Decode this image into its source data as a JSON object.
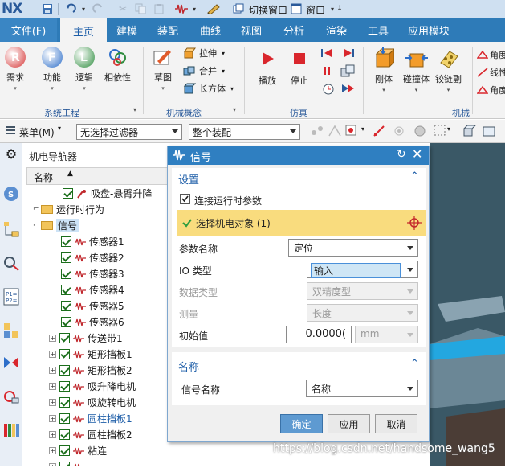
{
  "app": {
    "logo": "NX"
  },
  "qat": {
    "switch_window": "切换窗口",
    "window": "窗口"
  },
  "tabs": [
    "文件(F)",
    "主页",
    "建模",
    "装配",
    "曲线",
    "视图",
    "分析",
    "渲染",
    "工具",
    "应用模块"
  ],
  "ribbon": {
    "system_group": {
      "label": "系统工程",
      "buttons": [
        "需求",
        "功能",
        "逻辑",
        "相依性"
      ]
    },
    "mech_group": {
      "label": "机械概念",
      "sketch": "草图",
      "small": [
        "拉伸",
        "合并",
        "长方体"
      ]
    },
    "sim_group": {
      "label": "仿真",
      "buttons": [
        "播放",
        "停止"
      ]
    },
    "machine_group": {
      "label": "机械",
      "buttons": [
        "刚体",
        "碰撞体",
        "铰链副"
      ],
      "partial": [
        "角度",
        "线性",
        "角度"
      ]
    }
  },
  "selbar": {
    "menu": "菜单(M)",
    "filter": "无选择过滤器",
    "scope": "整个装配"
  },
  "navigator": {
    "title": "机电导航器",
    "column": "名称",
    "rows": [
      {
        "label": "吸盘-悬臂升降",
        "type": "item"
      },
      {
        "label": "运行时行为",
        "type": "folder"
      },
      {
        "label": "信号",
        "type": "folder-selected"
      },
      {
        "label": "传感器1",
        "type": "signal"
      },
      {
        "label": "传感器2",
        "type": "signal"
      },
      {
        "label": "传感器3",
        "type": "signal"
      },
      {
        "label": "传感器4",
        "type": "signal"
      },
      {
        "label": "传感器5",
        "type": "signal"
      },
      {
        "label": "传感器6",
        "type": "signal"
      },
      {
        "label": "传送带1",
        "type": "signal-plus"
      },
      {
        "label": "矩形挡板1",
        "type": "signal-plus"
      },
      {
        "label": "矩形挡板2",
        "type": "signal-plus"
      },
      {
        "label": "吸升降电机",
        "type": "signal-plus"
      },
      {
        "label": "吸旋转电机",
        "type": "signal-plus"
      },
      {
        "label": "圆柱挡板1",
        "type": "signal-plus-blue"
      },
      {
        "label": "圆柱挡板2",
        "type": "signal-plus"
      },
      {
        "label": "粘连",
        "type": "signal-plus"
      },
      {
        "label": "...",
        "type": "signal-plus"
      }
    ]
  },
  "dialog": {
    "title": "信号",
    "settings_section": "设置",
    "connect_runtime": "连接运行时参数",
    "select_object": "选择机电对象 (1)",
    "param_name_label": "参数名称",
    "param_name_value": "定位",
    "io_type_label": "IO 类型",
    "io_type_value": "输入",
    "data_type_label": "数据类型",
    "data_type_value": "双精度型",
    "measure_label": "测量",
    "measure_value": "长度",
    "init_value_label": "初始值",
    "init_value": "0.0000(",
    "init_unit": "mm",
    "name_section": "名称",
    "signal_name_label": "信号名称",
    "signal_name_value": "名称",
    "ok": "确定",
    "apply": "应用",
    "cancel": "取消"
  },
  "watermark": "https://blog.csdn.net/handsome_wang5",
  "colors": {
    "accent": "#2f7fc1",
    "highlight": "#f9dc7e",
    "tab_bar": "#2e7bb8"
  }
}
